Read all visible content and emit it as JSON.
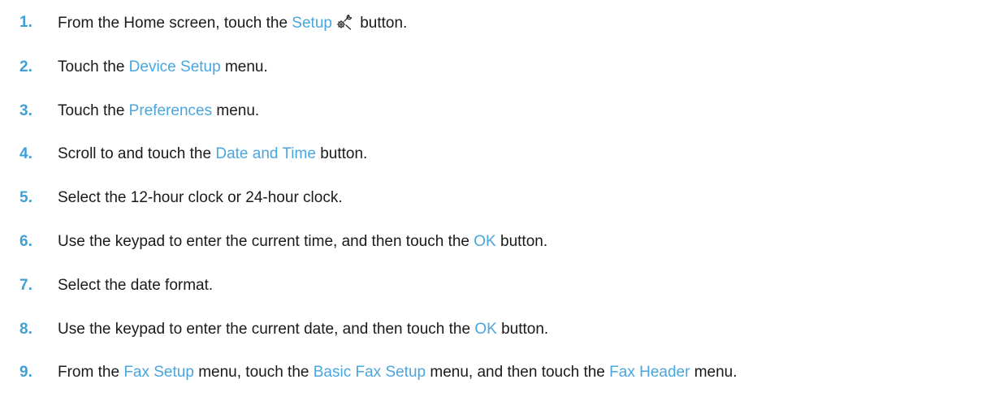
{
  "steps": [
    {
      "num": "1.",
      "parts": [
        {
          "t": "From the Home screen, touch the "
        },
        {
          "t": "Setup",
          "ui": true
        },
        {
          "icon": "setup-wrench-gear-icon"
        },
        {
          "t": " button."
        }
      ]
    },
    {
      "num": "2.",
      "parts": [
        {
          "t": "Touch the "
        },
        {
          "t": "Device Setup",
          "ui": true
        },
        {
          "t": " menu."
        }
      ]
    },
    {
      "num": "3.",
      "parts": [
        {
          "t": "Touch the "
        },
        {
          "t": "Preferences",
          "ui": true
        },
        {
          "t": " menu."
        }
      ]
    },
    {
      "num": "4.",
      "parts": [
        {
          "t": "Scroll to and touch the "
        },
        {
          "t": "Date and Time",
          "ui": true
        },
        {
          "t": " button."
        }
      ]
    },
    {
      "num": "5.",
      "parts": [
        {
          "t": "Select the 12-hour clock or 24-hour clock."
        }
      ]
    },
    {
      "num": "6.",
      "parts": [
        {
          "t": "Use the keypad to enter the current time, and then touch the "
        },
        {
          "t": "OK",
          "ui": true
        },
        {
          "t": " button."
        }
      ]
    },
    {
      "num": "7.",
      "parts": [
        {
          "t": "Select the date format."
        }
      ]
    },
    {
      "num": "8.",
      "parts": [
        {
          "t": "Use the keypad to enter the current date, and then touch the "
        },
        {
          "t": "OK",
          "ui": true
        },
        {
          "t": " button."
        }
      ]
    },
    {
      "num": "9.",
      "parts": [
        {
          "t": "From the "
        },
        {
          "t": "Fax Setup",
          "ui": true
        },
        {
          "t": " menu, touch the "
        },
        {
          "t": "Basic Fax Setup",
          "ui": true
        },
        {
          "t": " menu, and then touch the "
        },
        {
          "t": "Fax Header",
          "ui": true
        },
        {
          "t": " menu."
        }
      ]
    }
  ],
  "colors": {
    "step_number": "#3fa0d8",
    "ui_term": "#4aa6de",
    "body_text": "#1a1a1a"
  }
}
